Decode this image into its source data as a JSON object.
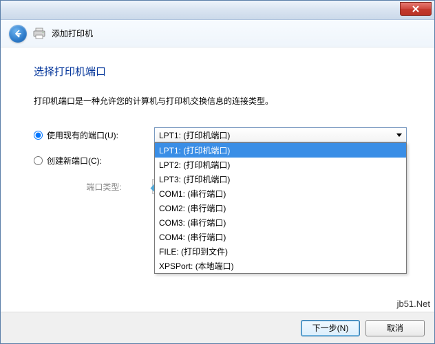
{
  "window": {
    "title": "添加打印机"
  },
  "page": {
    "heading": "选择打印机端口",
    "description": "打印机端口是一种允许您的计算机与打印机交换信息的连接类型。"
  },
  "form": {
    "use_existing_label": "使用现有的端口(U):",
    "create_new_label": "创建新端口(C):",
    "port_type_label": "端口类型:",
    "selected_port": "LPT1: (打印机端口)",
    "port_options": [
      "LPT1: (打印机端口)",
      "LPT2: (打印机端口)",
      "LPT3: (打印机端口)",
      "COM1: (串行端口)",
      "COM2: (串行端口)",
      "COM3: (串行端口)",
      "COM4: (串行端口)",
      "FILE: (打印到文件)",
      "XPSPort: (本地端口)"
    ]
  },
  "buttons": {
    "next": "下一步(N)",
    "cancel": "取消"
  },
  "watermark": "jb51.Net"
}
